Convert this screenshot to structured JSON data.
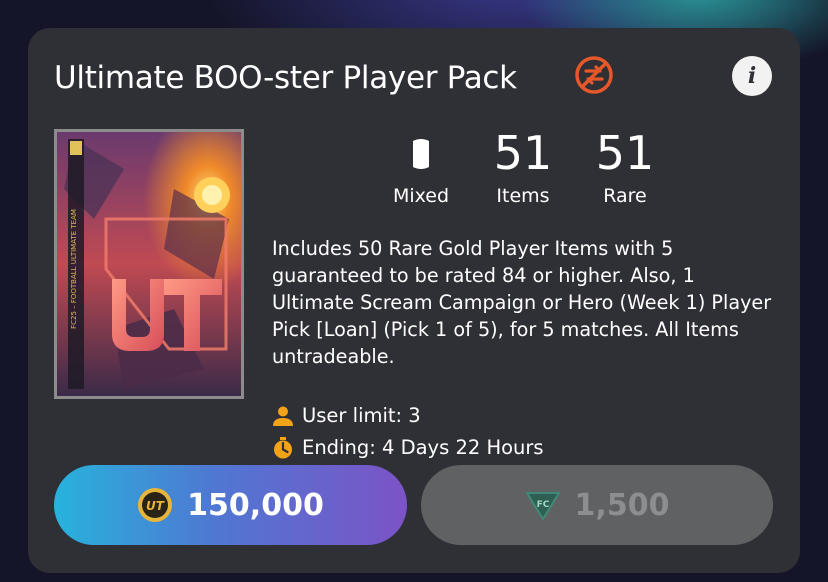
{
  "pack": {
    "title": "Ultimate BOO-ster Player Pack",
    "untradeable_icon": "no-trade-icon",
    "info_icon": "i",
    "art_label": "FC25 – FOOTBALL ULTIMATE TEAM"
  },
  "stats": [
    {
      "value": "",
      "label": "Mixed",
      "icon": "mixed-card-icon"
    },
    {
      "value": "51",
      "label": "Items"
    },
    {
      "value": "51",
      "label": "Rare"
    }
  ],
  "description": "Includes 50 Rare Gold Player Items with 5 guaranteed to be rated 84 or higher. Also, 1 Ultimate Scream Campaign or Hero (Week 1) Player Pick [Loan] (Pick 1 of 5), for 5 matches. All Items untradeable.",
  "meta": {
    "user_limit": "User limit: 3",
    "ending": "Ending: 4 Days 22 Hours"
  },
  "buy": {
    "coins": {
      "icon": "ut-coin-icon",
      "amount": "150,000"
    },
    "points": {
      "icon": "fc-points-icon",
      "amount": "1,500"
    }
  },
  "colors": {
    "card_bg": "#2f2f36",
    "accent_orange": "#f2a317",
    "no_trade_red": "#e4582a",
    "coins_gradient_start": "#27b3dc",
    "coins_gradient_end": "#7c53c7",
    "points_btn": "#606163"
  }
}
